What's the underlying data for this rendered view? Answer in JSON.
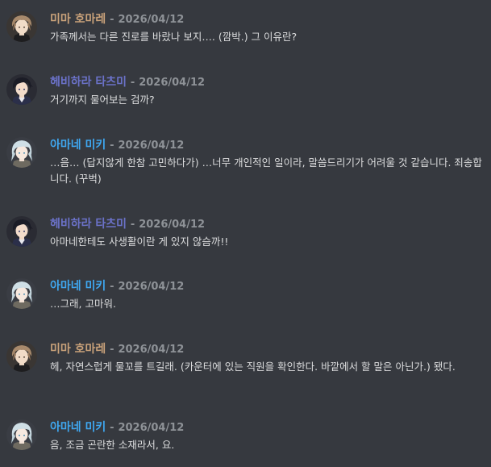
{
  "chat": {
    "messages": [
      {
        "author": "미마 호마레",
        "color": "#c9a27a",
        "avatar": "brown-haired-character-avatar",
        "date": "2026/04/12",
        "text": "가족께서는 다른 진로를 바랐나 보지…. (깜박.) 그 이유란?"
      },
      {
        "author": "헤비하라 타츠미",
        "color": "#6b72c9",
        "avatar": "dark-haired-character-avatar",
        "date": "2026/04/12",
        "text": "거기까지 물어보는 검까?"
      },
      {
        "author": "아마네 미키",
        "color": "#3fa7f0",
        "avatar": "silver-haired-character-avatar",
        "date": "2026/04/12",
        "text": "…음… (답지않게 한참 고민하다가) …너무 개인적인 일이라, 말씀드리기가 어려울 것 같습니다. 죄송합니다. (꾸벅)"
      },
      {
        "author": "헤비하라 타츠미",
        "color": "#6b72c9",
        "avatar": "dark-haired-character-avatar",
        "date": "2026/04/12",
        "text": "아마네한테도 사생활이란 게 있지 않슴까!!"
      },
      {
        "author": "아마네 미키",
        "color": "#3fa7f0",
        "avatar": "silver-haired-character-avatar",
        "date": "2026/04/12",
        "text": "…그래, 고마워."
      },
      {
        "author": "미마 호마레",
        "color": "#c9a27a",
        "avatar": "brown-haired-character-avatar",
        "date": "2026/04/12",
        "text": "헤, 자연스럽게 물꼬를 트길래. (카운터에 있는 직원을 확인한다. 바깥에서 할 말은 아닌가.) 됐다."
      },
      {
        "author": "아마네 미키",
        "color": "#3fa7f0",
        "avatar": "silver-haired-character-avatar",
        "date": "2026/04/12",
        "text": "음, 조금 곤란한 소재라서, 요."
      }
    ],
    "separator": "-"
  }
}
